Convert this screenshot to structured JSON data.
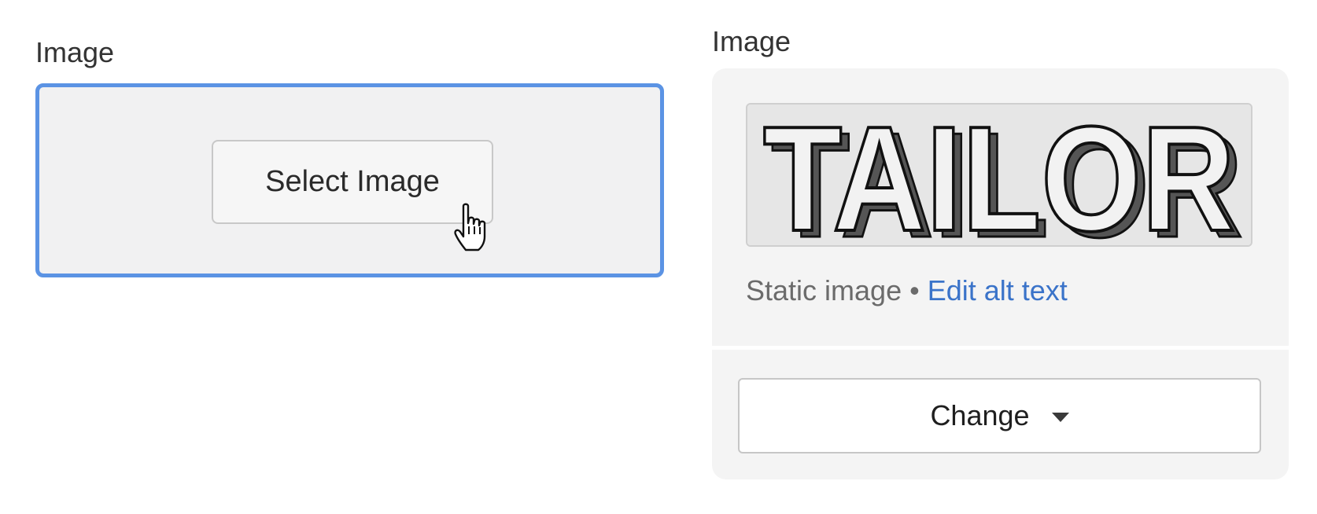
{
  "left_panel": {
    "label": "Image",
    "select_button_label": "Select Image",
    "focus_border_color": "#5b93e4"
  },
  "right_panel": {
    "label": "Image",
    "preview_text": "TAILOR",
    "image_type": "Static image",
    "separator": "•",
    "edit_alt_link": "Edit alt text",
    "change_button_label": "Change",
    "link_color": "#3a73c9"
  },
  "icons": {
    "cursor": "pointer-hand-cursor-icon",
    "change_caret": "caret-down-icon"
  }
}
